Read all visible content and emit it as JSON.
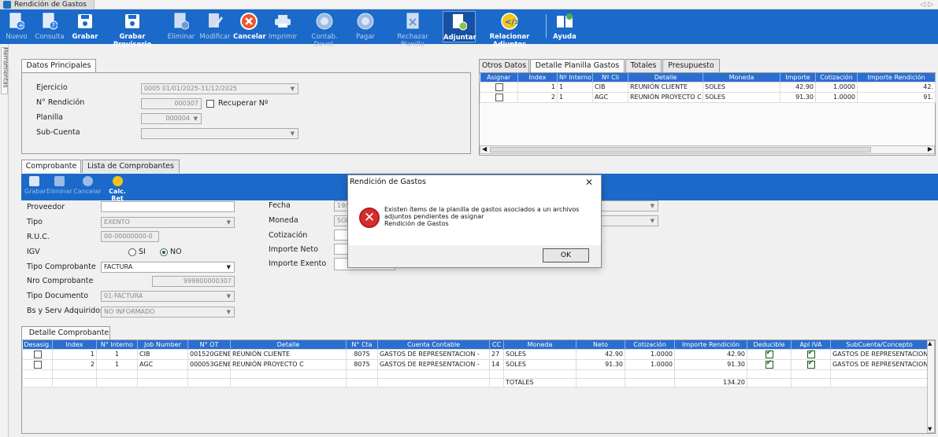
{
  "window": {
    "title": "Rendición de Gastos"
  },
  "toolbar": {
    "nuevo": "Nuevo",
    "consulta": "Consulta",
    "grabar": "Grabar",
    "grabar_provisorio": "Grabar Provisorio",
    "eliminar": "Eliminar",
    "modificar": "Modificar",
    "cancelar": "Cancelar",
    "imprimir": "Imprimir",
    "contab_devol": "Contab. Devol.",
    "pagar": "Pagar",
    "rechazar_planilla": "Rechazar Planilla",
    "adjuntar": "Adjuntar",
    "relacionar_adjuntos": "Relacionar Adjuntos",
    "ayuda": "Ayuda"
  },
  "sidebar": {
    "label": "Herramientas"
  },
  "datos_principales": {
    "tab": "Datos Principales",
    "ejercicio_label": "Ejercicio",
    "ejercicio_value": "0005 01/01/2025-31/12/2025",
    "nro_rendicion_label": "N° Rendición",
    "nro_rendicion_value": "000307",
    "recuperar_label": "Recuperar Nº",
    "planilla_label": "Planilla",
    "planilla_value": "000004",
    "subcuenta_label": "Sub-Cuenta",
    "subcuenta_value": ""
  },
  "right_tabs": [
    "Otros Datos",
    "Detalle Planilla Gastos",
    "Totales",
    "Presupuesto"
  ],
  "detalle_planilla": {
    "columns": [
      "Asignar",
      "Index",
      "Nº Interno",
      "Nº Cli",
      "Detalle",
      "Moneda",
      "Importe",
      "Cotización",
      "Importe Rendición"
    ],
    "rows": [
      {
        "index": "1",
        "interno": "1",
        "cli": "CIB",
        "detalle": "REUNIÓN CLIENTE",
        "moneda": "SOLES",
        "importe": "42.90",
        "cotizacion": "1.0000",
        "importe_rendicion": "42."
      },
      {
        "index": "2",
        "interno": "1",
        "cli": "AGC",
        "detalle": "REUNIÓN PROYECTO C",
        "moneda": "SOLES",
        "importe": "91.30",
        "cotizacion": "1.0000",
        "importe_rendicion": "91."
      }
    ]
  },
  "comprobante_tabs": [
    "Comprobante",
    "Lista de Comprobantes"
  ],
  "subtoolbar": {
    "grabar": "Grabar",
    "eliminar": "Eliminar",
    "cancelar": "Cancelar",
    "calc_ret": "Calc. Ret"
  },
  "comprobante": {
    "proveedor_label": "Proveedor",
    "proveedor_value": "",
    "tipo_label": "Tipo",
    "tipo_value": "EXENTO",
    "ruc_label": "R.U.C.",
    "ruc_value": "00-00000000-0",
    "igv_label": "IGV",
    "igv_si": "SI",
    "igv_no": "NO",
    "tipo_comprobante_label": "Tipo Comprobante",
    "tipo_comprobante_value": "FACTURA",
    "nro_comprobante_label": "Nro Comprobante",
    "nro_comprobante_value": "999800000307",
    "tipo_documento_label": "Tipo Documento",
    "tipo_documento_value": "01-FACTURA",
    "bs_serv_label": "Bs y Serv Adquiridos",
    "bs_serv_value": "NO INFORMADO",
    "fecha_label": "Fecha",
    "fecha_value": "19/",
    "moneda_label": "Moneda",
    "moneda_value": "SOL",
    "cotizacion_label": "Cotización",
    "importe_neto_label": "Importe Neto",
    "importe_exento_label": "Importe Exento"
  },
  "detalle_comprobante": {
    "tab": "Detalle Comprobante",
    "columns": [
      "Desasig.",
      "Index",
      "N° Interno",
      "Job Number",
      "N° OT",
      "Detalle",
      "N° Cta",
      "Cuenta Contable",
      "CC",
      "Moneda",
      "Neto",
      "Cotización",
      "Importe Rendición",
      "Deducible",
      "Apl IVA",
      "SubCuenta/Concepto"
    ],
    "rows": [
      {
        "index": "1",
        "interno": "1",
        "job": "CIB",
        "ot": "001520GENE",
        "detalle": "REUNIÓN CLIENTE",
        "cta": "8075",
        "cuenta": "GASTOS DE REPRESENTACION -",
        "cc": "27",
        "moneda": "SOLES",
        "neto": "42.90",
        "cotizacion": "1.0000",
        "importe_rendicion": "42.90",
        "subcuenta": "GASTOS DE REPRESENTACION"
      },
      {
        "index": "2",
        "interno": "1",
        "job": "AGC",
        "ot": "000053GENE",
        "detalle": "REUNIÓN PROYECTO C",
        "cta": "8075",
        "cuenta": "GASTOS DE REPRESENTACION -",
        "cc": "14",
        "moneda": "SOLES",
        "neto": "91.30",
        "cotizacion": "1.0000",
        "importe_rendicion": "91.30",
        "subcuenta": "GASTOS DE REPRESENTACION"
      }
    ],
    "totales_label": "TOTALES",
    "totales_value": "134.20"
  },
  "dialog": {
    "title": "Rendición de Gastos",
    "line1": "Existen ítems de la planilla de gastos asociados a un archivos",
    "line2": "adjuntos pendientes de asignar",
    "line3": "Rendición de Gastos",
    "ok": "OK"
  },
  "colors": {
    "toolbar": "#1b69c9",
    "grid_header": "#2a6fd0",
    "error": "#d32f2f"
  }
}
